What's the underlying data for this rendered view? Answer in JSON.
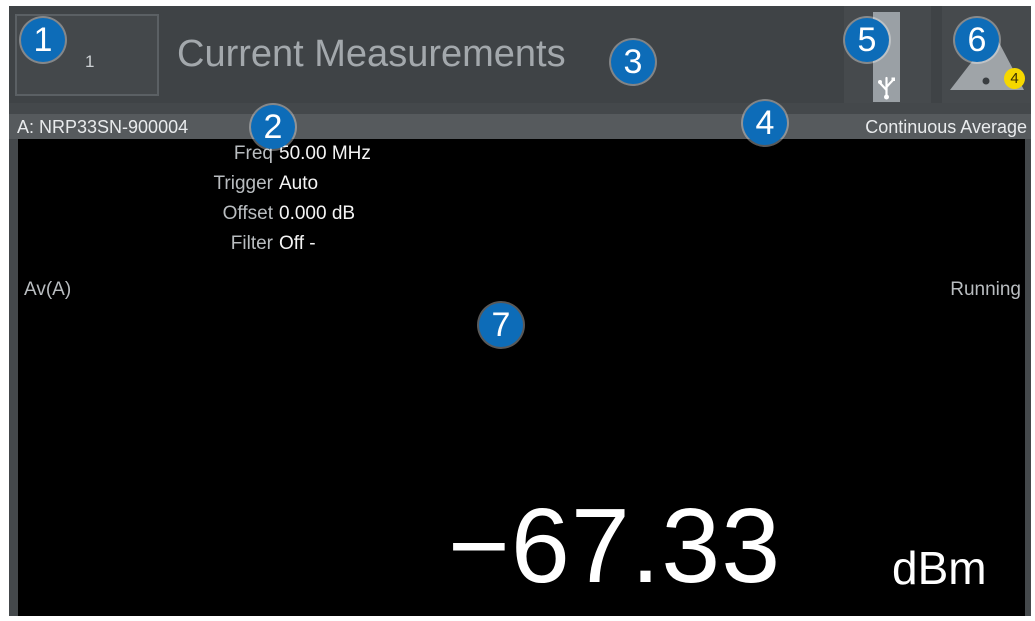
{
  "header": {
    "menu_button_label": "1",
    "title": "Current Measurements",
    "warning_count": "4"
  },
  "info_bar": {
    "sensor": "A: NRP33SN-900004",
    "mode": "Continuous Average"
  },
  "measurement": {
    "params": [
      {
        "label": "Freq",
        "value": "50.00 MHz"
      },
      {
        "label": "Trigger",
        "value": "Auto"
      },
      {
        "label": "Offset",
        "value": "0.000 dB"
      },
      {
        "label": "Filter",
        "value": "Off -"
      }
    ],
    "channel": "Av(A)",
    "status": "Running",
    "value": "−67.33",
    "unit": "dBm"
  },
  "callouts": {
    "c1": "1",
    "c2": "2",
    "c3": "3",
    "c4": "4",
    "c5": "5",
    "c6": "6",
    "c7": "7"
  },
  "icons": {
    "usb": "usb-icon",
    "warning": "warning-icon"
  },
  "colors": {
    "callout": "#0d6cb8",
    "badge": "#f6d800",
    "background": "#000000"
  }
}
